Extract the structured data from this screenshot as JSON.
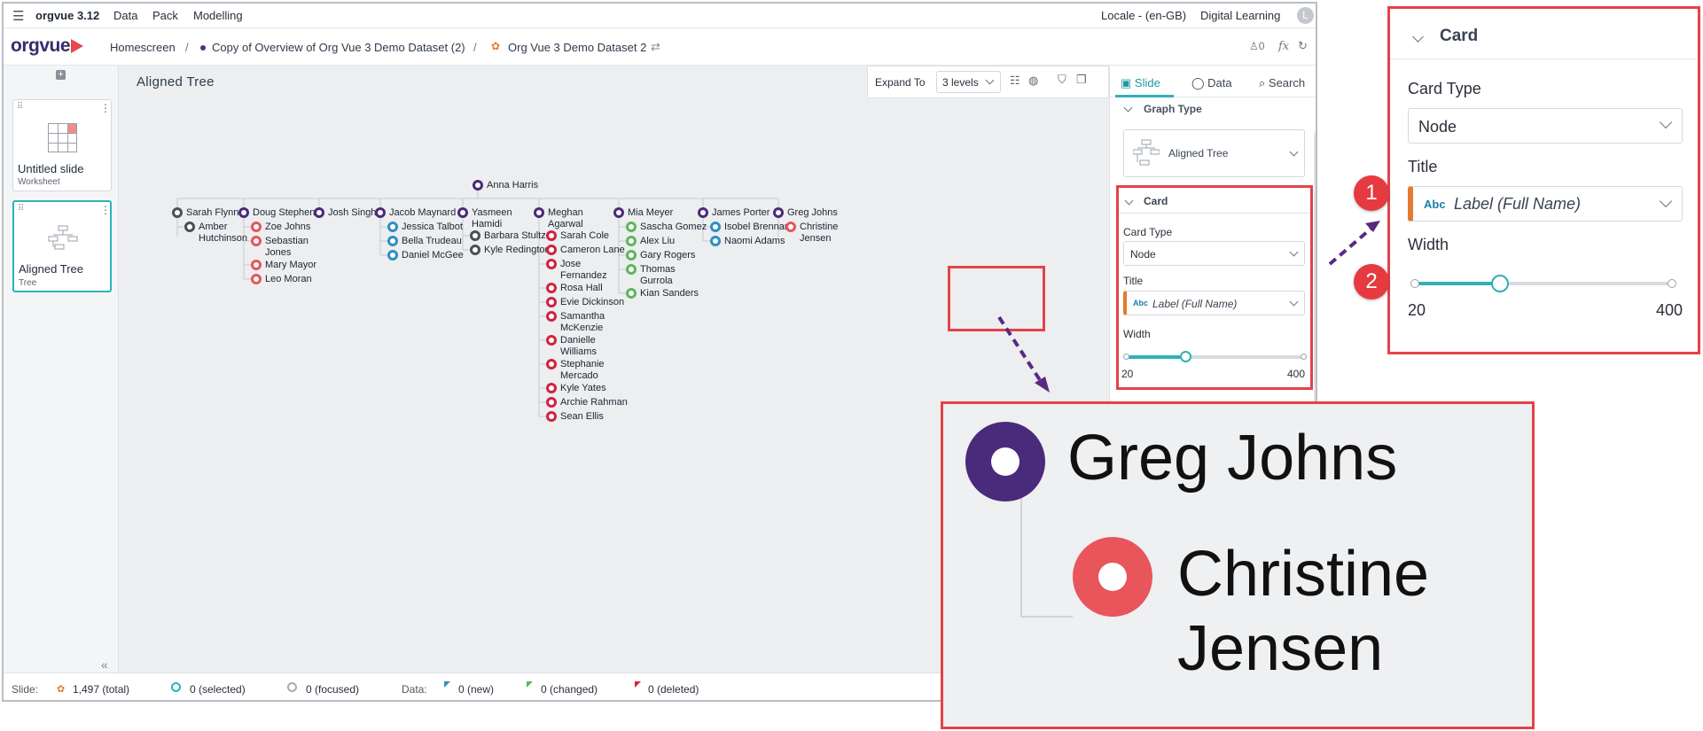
{
  "app": {
    "menu": {
      "version": "orgvue 3.12",
      "items": [
        "Data",
        "Pack",
        "Modelling"
      ]
    },
    "locale": "Locale - (en-GB)",
    "learning": "Digital Learning",
    "user_initial": "L",
    "logo": "orgvue",
    "breadcrumb": [
      "Homescreen",
      "/",
      "Copy of Overview of Org Vue 3 Demo Dataset (2)",
      "/",
      "Org Vue 3 Demo Dataset 2"
    ],
    "notif_count": "0",
    "fx": "fx"
  },
  "slides": [
    {
      "title": "Untitled slide",
      "subtitle": "Worksheet"
    },
    {
      "title": "Aligned Tree",
      "subtitle": "Tree"
    }
  ],
  "canvas": {
    "title": "Aligned Tree",
    "expand_label": "Expand To",
    "expand_value": "3 levels",
    "root": "Anna Harris",
    "groups": [
      {
        "name": "Sarah Flynn",
        "color": "#4b4f58",
        "children": [
          {
            "name": "Amber Hutchinson",
            "color": "#4b4f58"
          }
        ]
      },
      {
        "name": "Doug Stephens",
        "color": "#4a2a7a",
        "children": [
          {
            "name": "Zoe Johns",
            "color": "#e8555b"
          },
          {
            "name": "Sebastian Jones",
            "color": "#e8555b"
          },
          {
            "name": "Mary Mayor",
            "color": "#e8555b"
          },
          {
            "name": "Leo Moran",
            "color": "#e8555b"
          }
        ]
      },
      {
        "name": "Josh Singh",
        "color": "#4a2a7a",
        "children": []
      },
      {
        "name": "Jacob Maynard",
        "color": "#4a2a7a",
        "children": [
          {
            "name": "Jessica Talbot",
            "color": "#2e8fc2"
          },
          {
            "name": "Bella Trudeau",
            "color": "#2e8fc2"
          },
          {
            "name": "Daniel McGee",
            "color": "#2e8fc2"
          }
        ]
      },
      {
        "name": "Yasmeen Hamidi",
        "color": "#4a2a7a",
        "children": [
          {
            "name": "Barbara Stultz",
            "color": "#4b4f58"
          },
          {
            "name": "Kyle Redington",
            "color": "#4b4f58"
          }
        ]
      },
      {
        "name": "Meghan Agarwal",
        "color": "#4a2a7a",
        "children": [
          {
            "name": "Sarah Cole",
            "color": "#d1223f"
          },
          {
            "name": "Cameron Lane",
            "color": "#d1223f"
          },
          {
            "name": "Jose Fernandez",
            "color": "#d1223f"
          },
          {
            "name": "Rosa Hall",
            "color": "#d1223f"
          },
          {
            "name": "Evie Dickinson",
            "color": "#d1223f"
          },
          {
            "name": "Samantha McKenzie",
            "color": "#d1223f"
          },
          {
            "name": "Danielle Williams",
            "color": "#d1223f"
          },
          {
            "name": "Stephanie Mercado",
            "color": "#d1223f"
          },
          {
            "name": "Kyle Yates",
            "color": "#d1223f"
          },
          {
            "name": "Archie Rahman",
            "color": "#d1223f"
          },
          {
            "name": "Sean Ellis",
            "color": "#d1223f"
          }
        ]
      },
      {
        "name": "Mia Meyer",
        "color": "#4a2a7a",
        "children": [
          {
            "name": "Sascha Gomez",
            "color": "#5fb55e"
          },
          {
            "name": "Alex Liu",
            "color": "#5fb55e"
          },
          {
            "name": "Gary Rogers",
            "color": "#5fb55e"
          },
          {
            "name": "Thomas Gurrola",
            "color": "#5fb55e"
          },
          {
            "name": "Kian Sanders",
            "color": "#5fb55e"
          }
        ]
      },
      {
        "name": "James Porter",
        "color": "#4a2a7a",
        "children": [
          {
            "name": "Isobel Brennan",
            "color": "#2e8fc2"
          },
          {
            "name": "Naomi Adams",
            "color": "#2e8fc2"
          }
        ]
      },
      {
        "name": "Greg Johns",
        "color": "#4a2a7a",
        "children": [
          {
            "name": "Christine Jensen",
            "color": "#e8555b"
          }
        ]
      }
    ]
  },
  "panel": {
    "tabs": [
      "Slide",
      "Data",
      "Search"
    ],
    "graph_type_header": "Graph Type",
    "graph_type_value": "Aligned Tree",
    "card_header": "Card",
    "card_type_label": "Card Type",
    "card_type_value": "Node",
    "title_label": "Title",
    "title_prefix": "Abc",
    "title_value": "Label (Full Name)",
    "width_label": "Width",
    "width_min": "20",
    "width_max": "400",
    "width_value_fraction": 0.33
  },
  "status": {
    "slide_label": "Slide:",
    "total": "1,497 (total)",
    "selected": "0 (selected)",
    "focused": "0 (focused)",
    "data_label": "Data:",
    "new": "0 (new)",
    "changed": "0 (changed)",
    "deleted": "0 (deleted)"
  },
  "zoom": {
    "badges": [
      "1",
      "2"
    ],
    "parent": "Greg Johns",
    "child": "Christine Jensen"
  },
  "colors": {
    "accent": "#2fb1b8",
    "highlight": "#e2434b",
    "annotation_arrow": "#5a2a82"
  }
}
